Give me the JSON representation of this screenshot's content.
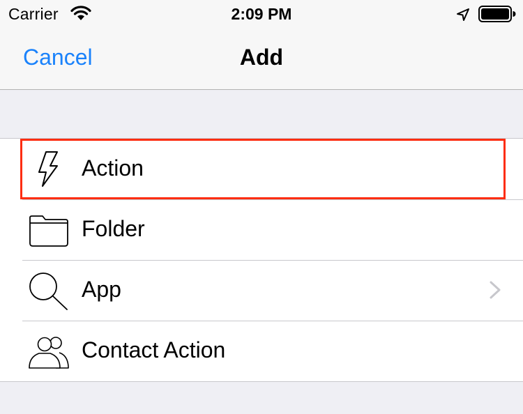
{
  "status_bar": {
    "carrier": "Carrier",
    "time": "2:09 PM",
    "icons": [
      "wifi-icon",
      "location-arrow-icon",
      "battery-icon"
    ]
  },
  "nav": {
    "cancel_label": "Cancel",
    "title": "Add"
  },
  "list": {
    "items": [
      {
        "label": "Action",
        "icon": "lightning-bolt-icon",
        "highlighted": true,
        "has_chevron": false
      },
      {
        "label": "Folder",
        "icon": "folder-icon",
        "highlighted": false,
        "has_chevron": false
      },
      {
        "label": "App",
        "icon": "magnifier-icon",
        "highlighted": false,
        "has_chevron": true
      },
      {
        "label": "Contact Action",
        "icon": "contacts-icon",
        "highlighted": false,
        "has_chevron": false
      }
    ]
  },
  "colors": {
    "accent": "#1a82fb",
    "highlight_border": "#fd2d12",
    "background": "#efeff4"
  }
}
